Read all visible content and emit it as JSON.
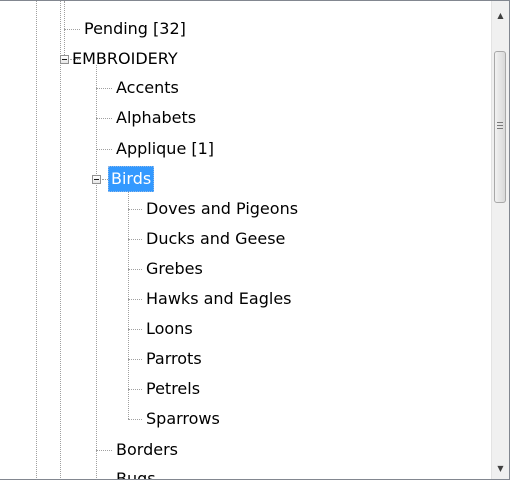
{
  "tree": {
    "items": [
      {
        "label": "Pending [32]"
      },
      {
        "label": "EMBROIDERY"
      },
      {
        "label": "Accents"
      },
      {
        "label": "Alphabets"
      },
      {
        "label": "Applique [1]"
      },
      {
        "label": "Birds"
      },
      {
        "label": "Doves and Pigeons"
      },
      {
        "label": "Ducks and Geese"
      },
      {
        "label": "Grebes"
      },
      {
        "label": "Hawks and Eagles"
      },
      {
        "label": "Loons"
      },
      {
        "label": "Parrots"
      },
      {
        "label": "Petrels"
      },
      {
        "label": "Sparrows"
      },
      {
        "label": "Borders"
      },
      {
        "label": "Bugs"
      }
    ],
    "selected": "Birds",
    "selection_color": "#3399ff"
  },
  "scrollbar": {
    "up_arrow": "▲",
    "down_arrow": "▼"
  }
}
